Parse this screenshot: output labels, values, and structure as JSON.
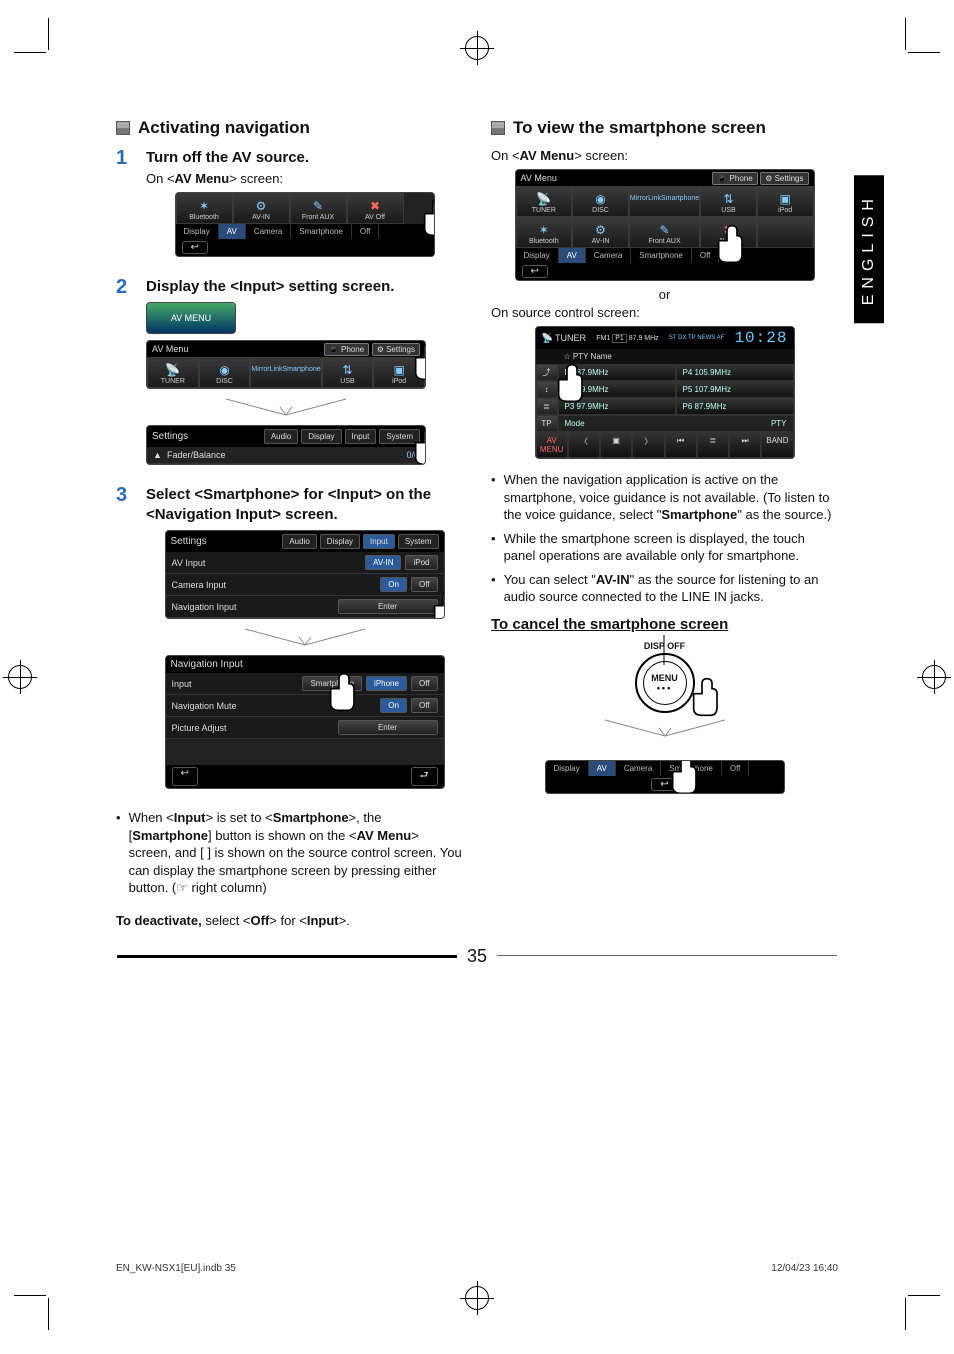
{
  "page_number": "35",
  "language_tab": "ENGLISH",
  "footer": {
    "file": "EN_KW-NSX1[EU].indb   35",
    "stamp": "12/04/23   16:40"
  },
  "left": {
    "section_title": "Activating navigation",
    "step1": {
      "num": "1",
      "title": "Turn off the AV source.",
      "sub_prefix": "On <",
      "sub_bold": "AV Menu",
      "sub_suffix": "> screen:"
    },
    "shot1": {
      "tabs": {
        "display": "Display",
        "av": "AV",
        "camera": "Camera",
        "smartphone": "Smartphone",
        "off": "Off"
      },
      "cells": {
        "bluetooth": "Bluetooth",
        "avin": "AV-IN",
        "frontaux": "Front AUX",
        "avoff": "AV Off"
      }
    },
    "step2": {
      "num": "2",
      "title": "Display the <Input> setting screen."
    },
    "shot2": {
      "avmenu_label": "AV MENU",
      "title": "AV Menu",
      "btn_phone": "Phone",
      "btn_settings": "Settings",
      "cells": {
        "tuner": "TUNER",
        "disc": "DISC",
        "mirror1": "MirrorLink",
        "mirror2": "Smartphone",
        "usb": "USB",
        "ipod": "iPod"
      },
      "settings_title": "Settings",
      "settings_tabs": {
        "audio": "Audio",
        "display": "Display",
        "input": "Input",
        "system": "System"
      },
      "fader_row": "Fader/Balance",
      "fader_val": "0/0"
    },
    "step3": {
      "num": "3",
      "title": "Select <Smartphone> for <Input> on the <Navigation Input> screen."
    },
    "shot3a": {
      "title": "Settings",
      "tabs": {
        "audio": "Audio",
        "display": "Display",
        "input": "Input",
        "system": "System"
      },
      "rows": {
        "av_input": "AV Input",
        "av_in": "AV-IN",
        "ipod": "iPod",
        "camera_input": "Camera Input",
        "on": "On",
        "off": "Off",
        "nav_input": "Navigation Input",
        "enter": "Enter"
      }
    },
    "shot3b": {
      "title": "Navigation Input",
      "rows": {
        "input": "Input",
        "smartphone": "Smartphone",
        "iphone": "iPhone",
        "off": "Off",
        "nav_mute": "Navigation Mute",
        "on": "On",
        "pic_adj": "Picture Adjust",
        "enter": "Enter"
      }
    },
    "note_html": {
      "pre": "When <",
      "b1": "Input",
      "mid1": "> is set to <",
      "b2": "Smartphone",
      "mid2": ">, the [",
      "b3": "Smartphone",
      "mid3": "] button is shown on the <",
      "b4": "AV Menu",
      "post": "> screen, and [  ] is shown on the source control screen. You can display the smartphone screen by pressing either button. (☞ right column)"
    },
    "deactivate": {
      "lead": "To deactivate,",
      "rest_pre": " select <",
      "b": "Off",
      "rest_mid": "> for <",
      "b2": "Input",
      "rest_post": ">."
    }
  },
  "right": {
    "section_title": "To view the smartphone screen",
    "sub1_prefix": "On <",
    "sub1_bold": "AV Menu",
    "sub1_suffix": "> screen:",
    "shotA": {
      "title": "AV Menu",
      "btn_phone": "Phone",
      "btn_settings": "Settings",
      "row1": {
        "tuner": "TUNER",
        "disc": "DISC",
        "mirror1": "MirrorLink",
        "mirror2": "Smartphone",
        "usb": "USB",
        "ipod": "iPod"
      },
      "row2": {
        "bluetooth": "Bluetooth",
        "avin": "AV-IN",
        "frontaux": "Front AUX",
        "avoff": "AV Off"
      },
      "tabs": {
        "display": "Display",
        "av": "AV",
        "camera": "Camera",
        "smartphone": "Smartphone",
        "off": "Off"
      }
    },
    "or": "or",
    "sub2": "On source control screen:",
    "tuner": {
      "label": "TUNER",
      "band": "FM1",
      "preset_badge": "P1",
      "freq": "87.9 MHz",
      "flags": "ST   DX   TP   NEWS   AF",
      "clock": "10:28",
      "pty": "PTY Name",
      "left_btns": {
        "b1": "⤴",
        "b2": "↕",
        "b3": "≣",
        "b4": "TP"
      },
      "presets": {
        "p1": "P1 87.9MHz",
        "p2": "P2 89.9MHz",
        "p3": "P3 97.9MHz",
        "p4": "P4 105.9MHz",
        "p5": "P5 107.9MHz",
        "p6": "P6 87.9MHz"
      },
      "bottom": {
        "mode": "Mode",
        "avmenu": "AV MENU",
        "pty": "PTY",
        "band": "BAND"
      }
    },
    "notes": {
      "n1_pre": "When the navigation application is active on the smartphone, voice guidance is not available. (To listen to the voice guidance, select \"",
      "n1_b": "Smartphone",
      "n1_post": "\" as the source.)",
      "n2": "While the smartphone screen is displayed, the touch panel operations are available only for smartphone.",
      "n3_pre": "You can select \"",
      "n3_b": "AV-IN",
      "n3_post": "\" as the source for listening to an audio source connected to the LINE IN jacks."
    },
    "cancel_head": "To cancel the smartphone screen",
    "dispoff_label": "DISP OFF",
    "menu_label": "MENU",
    "strip": {
      "display": "Display",
      "av": "AV",
      "camera": "Camera",
      "smartphone": "Smartphone",
      "off": "Off"
    }
  }
}
